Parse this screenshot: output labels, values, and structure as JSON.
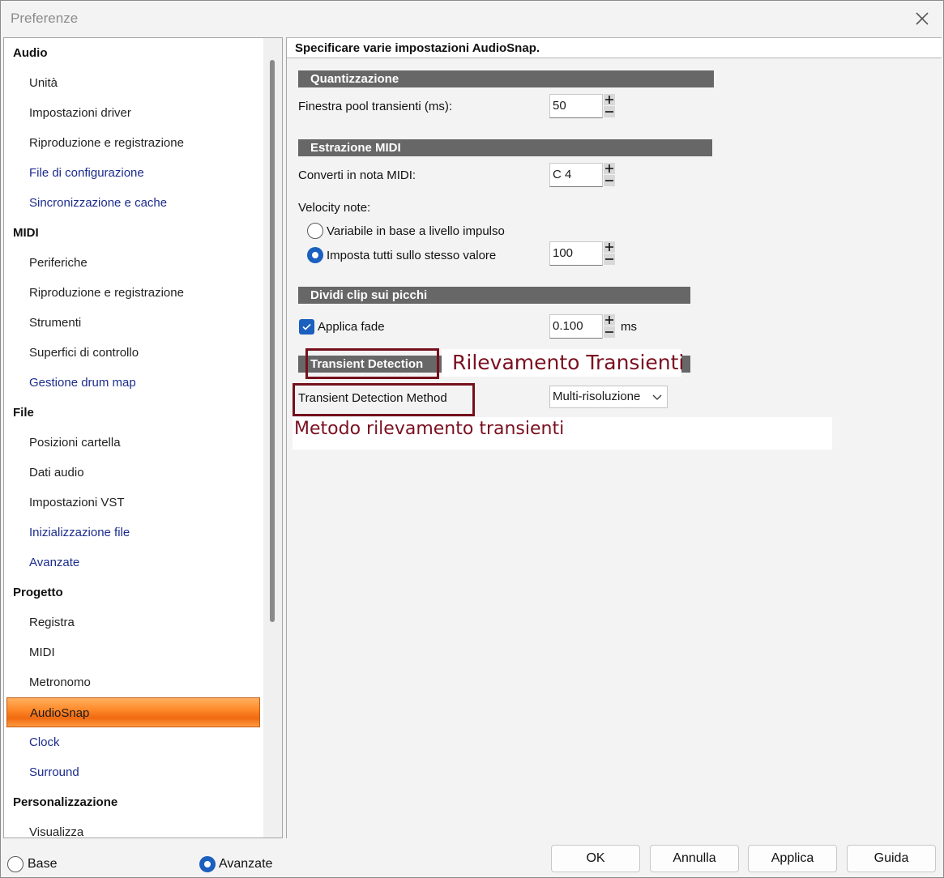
{
  "window": {
    "title": "Preferenze"
  },
  "sidebar": {
    "items": [
      {
        "type": "group",
        "label": "Audio"
      },
      {
        "type": "item",
        "label": "Unità"
      },
      {
        "type": "item",
        "label": "Impostazioni driver"
      },
      {
        "type": "item",
        "label": "Riproduzione e registrazione"
      },
      {
        "type": "link",
        "label": "File di configurazione"
      },
      {
        "type": "link",
        "label": "Sincronizzazione e cache"
      },
      {
        "type": "group",
        "label": "MIDI"
      },
      {
        "type": "item",
        "label": "Periferiche"
      },
      {
        "type": "item",
        "label": "Riproduzione e registrazione"
      },
      {
        "type": "item",
        "label": "Strumenti"
      },
      {
        "type": "item",
        "label": "Superfici di controllo"
      },
      {
        "type": "link",
        "label": "Gestione drum map"
      },
      {
        "type": "group",
        "label": "File"
      },
      {
        "type": "item",
        "label": "Posizioni cartella"
      },
      {
        "type": "item",
        "label": "Dati audio"
      },
      {
        "type": "item",
        "label": "Impostazioni VST"
      },
      {
        "type": "link",
        "label": "Inizializzazione file"
      },
      {
        "type": "link",
        "label": "Avanzate"
      },
      {
        "type": "group",
        "label": "Progetto"
      },
      {
        "type": "item",
        "label": "Registra"
      },
      {
        "type": "item",
        "label": "MIDI"
      },
      {
        "type": "item",
        "label": "Metronomo"
      },
      {
        "type": "selected",
        "label": "AudioSnap"
      },
      {
        "type": "link",
        "label": "Clock"
      },
      {
        "type": "link",
        "label": "Surround"
      },
      {
        "type": "group",
        "label": "Personalizzazione"
      },
      {
        "type": "item",
        "label": "Visualizza"
      }
    ]
  },
  "panel": {
    "header": "Specificare varie impostazioni AudioSnap.",
    "quantize": {
      "section": "Quantizzazione",
      "pool_label": "Finestra pool transienti (ms):",
      "pool_value": "50"
    },
    "midi_extract": {
      "section": "Estrazione MIDI",
      "convert_label": "Converti in nota MIDI:",
      "convert_value": "C 4",
      "velocity_label": "Velocity note:",
      "option_variable": "Variabile in base a livello impulso",
      "option_fixed": "Imposta tutti sullo stesso valore",
      "fixed_value": "100",
      "selected_option": "fixed"
    },
    "split": {
      "section": "Dividi clip sui picchi",
      "fade_label": "Applica fade",
      "fade_checked": true,
      "fade_value": "0.100",
      "fade_unit": "ms"
    },
    "transient": {
      "section": "Transient Detection",
      "section_annotation": "Rilevamento Transienti",
      "method_label": "Transient Detection Method",
      "method_value": "Multi-risoluzione",
      "method_annotation": "Metodo rilevamento transienti"
    }
  },
  "footer": {
    "mode_basic": "Base",
    "mode_advanced": "Avanzate",
    "selected_mode": "advanced",
    "ok": "OK",
    "cancel": "Annulla",
    "apply": "Applica",
    "help": "Guida"
  },
  "colors": {
    "section_bar": "#676767",
    "selection": "#ff8a2a",
    "accent": "#1b5fbf",
    "link": "#1c2c8c",
    "annotation": "#74101c"
  }
}
